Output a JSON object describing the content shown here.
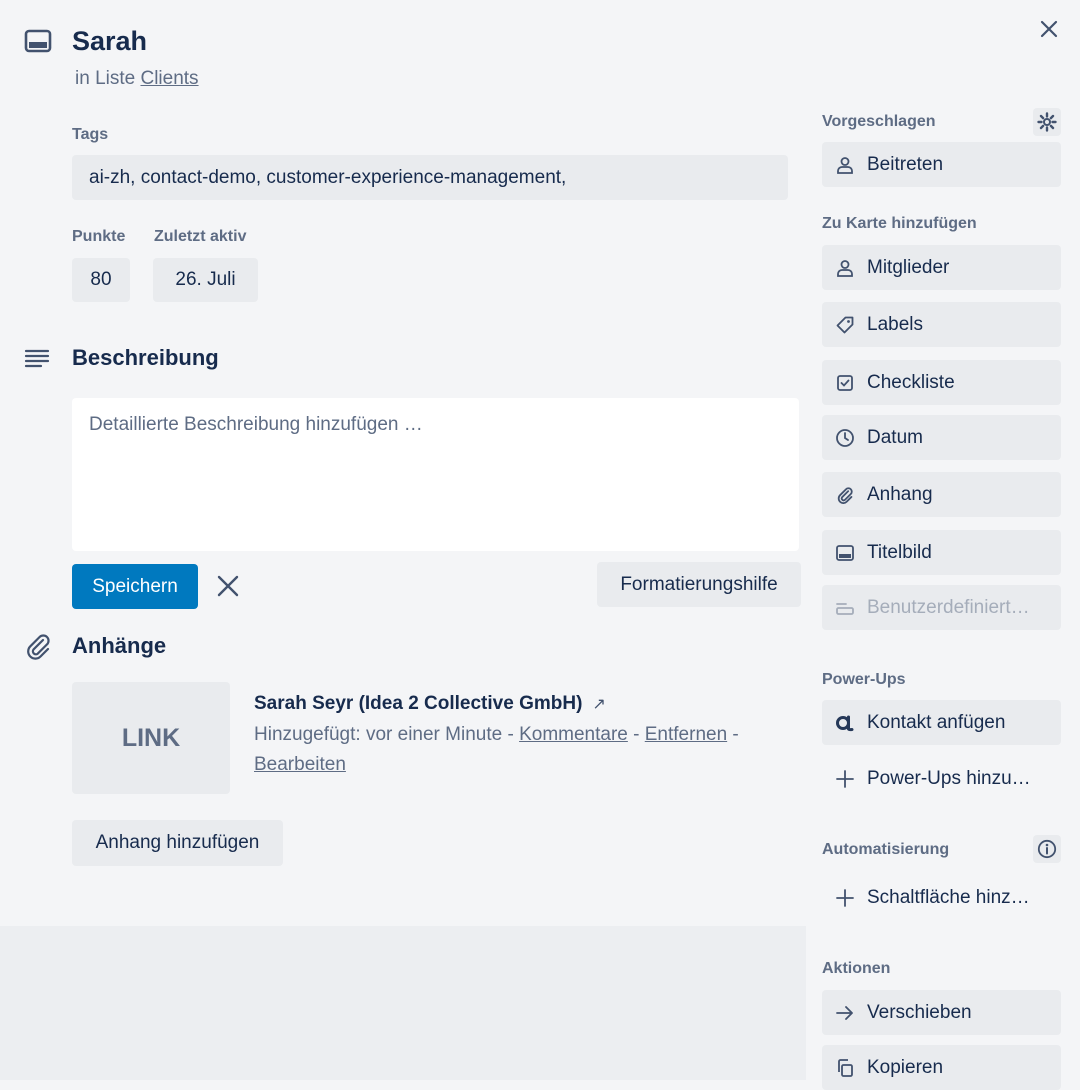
{
  "card": {
    "title": "Sarah",
    "list_prefix": "in Liste ",
    "list_name": "Clients"
  },
  "fields": {
    "tags_label": "Tags",
    "tags_value": "ai-zh, contact-demo, customer-experience-management,",
    "points_label": "Punkte",
    "points_value": "80",
    "last_active_label": "Zuletzt aktiv",
    "last_active_value": "26. Juli"
  },
  "description": {
    "title": "Beschreibung",
    "placeholder": "Detaillierte Beschreibung hinzufügen …",
    "save_label": "Speichern",
    "format_help_label": "Formatierungshilfe"
  },
  "attachments": {
    "title": "Anhänge",
    "thumb_label": "LINK",
    "item_name": "Sarah Seyr (Idea 2 Collective GmbH)",
    "item_arrow": "↗",
    "added_text": "Hinzugefügt: vor einer Minute - ",
    "comments_link": "Kommentare",
    "sep1": " - ",
    "remove_link": "Entfernen",
    "sep2": " -",
    "edit_link": "Bearbeiten",
    "add_label": "Anhang hinzufügen"
  },
  "sidebar": {
    "suggested_label": "Vorgeschlagen",
    "join_label": "Beitreten",
    "add_to_card_label": "Zu Karte hinzufügen",
    "members_label": "Mitglieder",
    "labels_label": "Labels",
    "checklist_label": "Checkliste",
    "date_label": "Datum",
    "attachment_label": "Anhang",
    "cover_label": "Titelbild",
    "custom_label": "Benutzerdefiniert…",
    "powerups_label": "Power-Ups",
    "add_contact_label": "Kontakt anfügen",
    "add_powerups_label": "Power-Ups hinzu…",
    "automation_label": "Automatisierung",
    "add_button_label": "Schaltfläche hinz…",
    "actions_label": "Aktionen",
    "move_label": "Verschieben",
    "copy_label": "Kopieren"
  },
  "colors": {
    "primary": "#0079bf",
    "text": "#172b4d",
    "muted": "#5e6c84",
    "button_bg": "#e9ebee",
    "page_bg": "#f4f5f7"
  }
}
